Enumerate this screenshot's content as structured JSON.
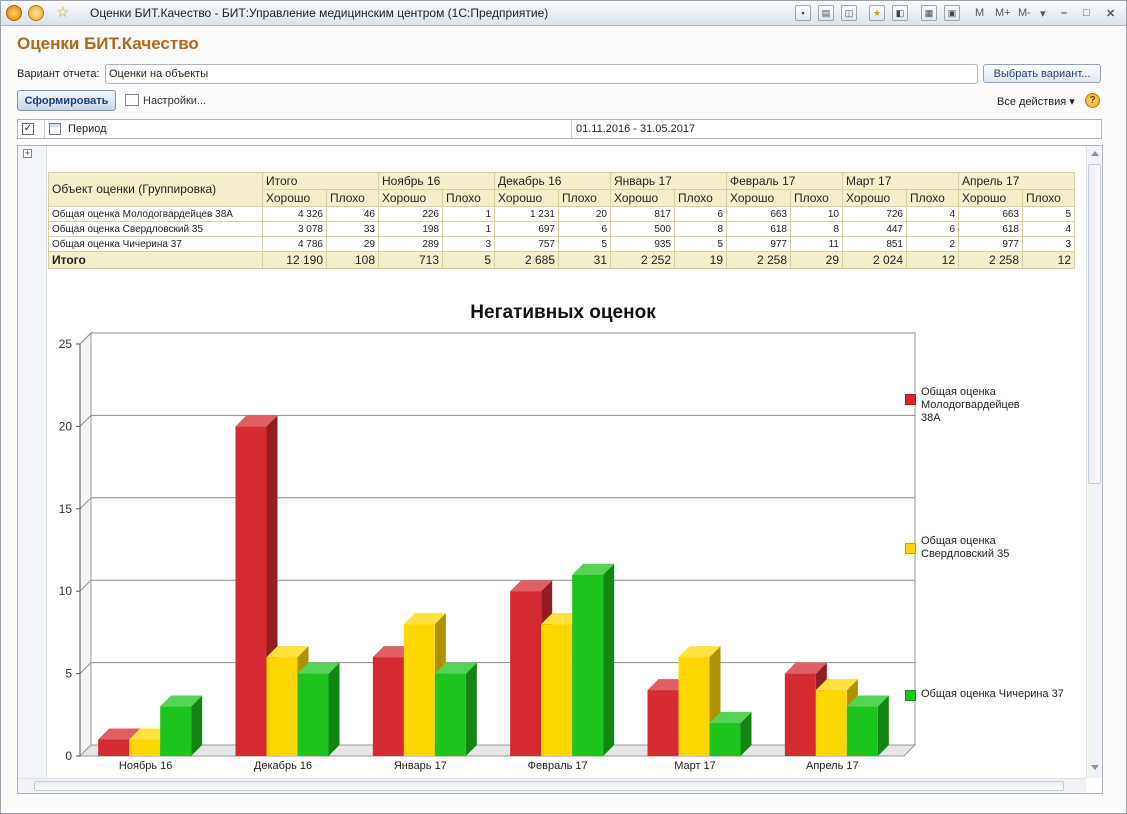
{
  "window": {
    "title": "Оценки БИТ.Качество - БИТ:Управление медицинским центром  (1С:Предприятие)",
    "memory_buttons": [
      "M",
      "M+",
      "M-"
    ]
  },
  "page": {
    "title": "Оценки БИТ.Качество",
    "variant_label": "Вариант отчета:",
    "variant_value": "Оценки на объекты",
    "choose_variant_button": "Выбрать вариант...",
    "form_button": "Сформировать",
    "settings_link": "Настройки...",
    "all_actions": "Все действия ▾",
    "help": "?"
  },
  "period": {
    "label": "Период",
    "value": "01.11.2016 - 31.05.2017",
    "checked": true
  },
  "table": {
    "group_header": "Объект оценки (Группировка)",
    "months": [
      "Итого",
      "Ноябрь 16",
      "Декабрь 16",
      "Январь 17",
      "Февраль 17",
      "Март 17",
      "Апрель 17"
    ],
    "sub_headers": [
      "Хорошо",
      "Плохо"
    ],
    "rows": [
      {
        "name": "Общая оценка Молодогвардейцев  38А",
        "values": [
          "4 326",
          "46",
          "226",
          "1",
          "1 231",
          "20",
          "817",
          "6",
          "663",
          "10",
          "726",
          "4",
          "663",
          "5"
        ]
      },
      {
        "name": "Общая оценка Свердловский 35",
        "values": [
          "3 078",
          "33",
          "198",
          "1",
          "697",
          "6",
          "500",
          "8",
          "618",
          "8",
          "447",
          "6",
          "618",
          "4"
        ]
      },
      {
        "name": "Общая оценка Чичерина 37",
        "values": [
          "4 786",
          "29",
          "289",
          "3",
          "757",
          "5",
          "935",
          "5",
          "977",
          "11",
          "851",
          "2",
          "977",
          "3"
        ]
      }
    ],
    "total": {
      "name": "Итого",
      "values": [
        "12 190",
        "108",
        "713",
        "5",
        "2 685",
        "31",
        "2 252",
        "19",
        "2 258",
        "29",
        "2 024",
        "12",
        "2 258",
        "12"
      ]
    }
  },
  "chart_data": {
    "type": "bar",
    "title": "Негативных  оценок",
    "categories": [
      "Ноябрь 16",
      "Декабрь 16",
      "Январь 17",
      "Февраль 17",
      "Март 17",
      "Апрель 17"
    ],
    "series": [
      {
        "name": "Общая оценка Молодогвардейцев  38А",
        "color": "#d42a31",
        "values": [
          1,
          20,
          6,
          10,
          4,
          5
        ]
      },
      {
        "name": "Общая оценка Свердловский 35",
        "color": "#ffd700",
        "values": [
          1,
          6,
          8,
          8,
          6,
          4
        ]
      },
      {
        "name": "Общая оценка Чичерина 37",
        "color": "#1ec41e",
        "values": [
          3,
          5,
          5,
          11,
          2,
          3
        ]
      }
    ],
    "yticks": [
      "0",
      "5",
      "10",
      "15",
      "20",
      "25"
    ],
    "ylim": [
      0,
      25
    ],
    "grid": true,
    "legend_position": "right"
  }
}
